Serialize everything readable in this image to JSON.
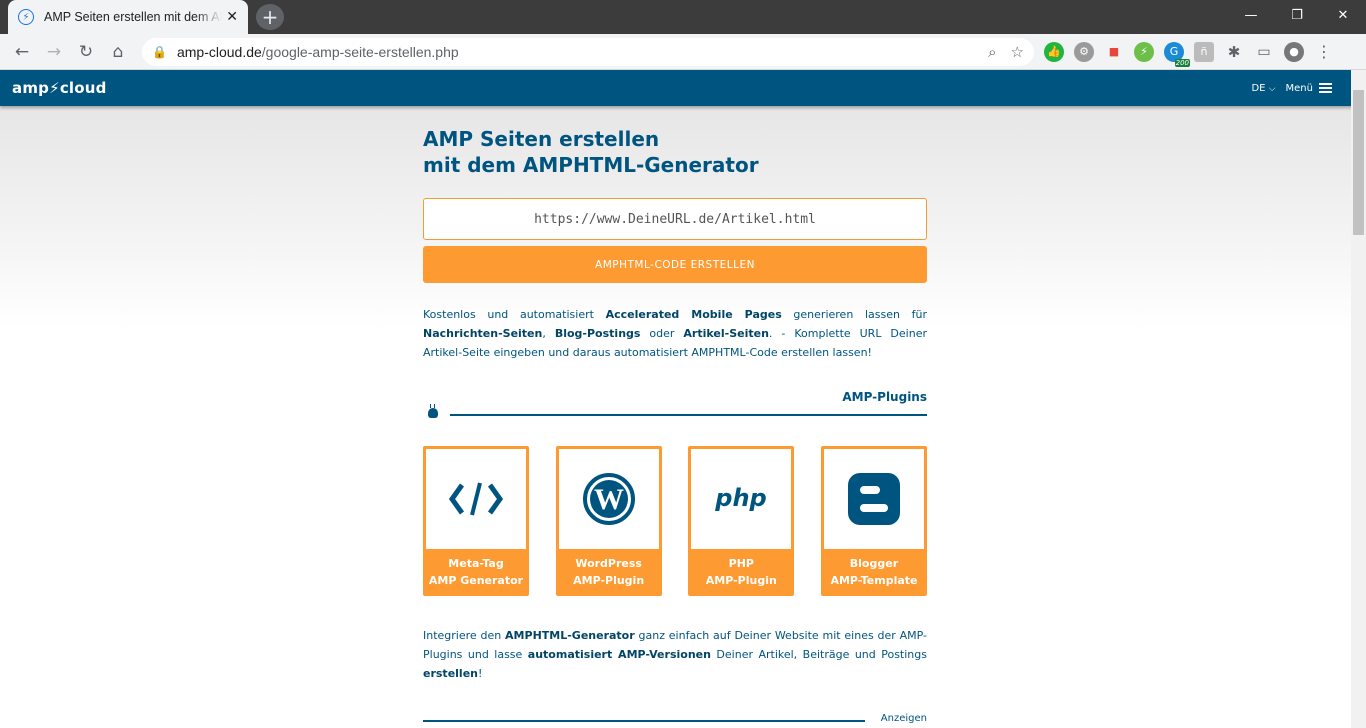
{
  "browser": {
    "tab_title": "AMP Seiten erstellen mit dem AMPHTML-Generator",
    "url_host": "amp-cloud.de",
    "url_path": "/google-amp-seite-erstellen.php",
    "ext_badge": "200"
  },
  "header": {
    "logo": "amp⚡cloud",
    "lang": "DE",
    "menu": "Menü"
  },
  "hero": {
    "title_line1": "AMP Seiten erstellen",
    "title_line2": "mit dem AMPHTML-Generator",
    "url_placeholder": "https://www.DeineURL.de/Artikel.html",
    "cta_label": "AMPHTML-CODE ERSTELLEN"
  },
  "intro": {
    "t1": "Kostenlos und automatisiert ",
    "b1": "Accelerated Mobile Pages",
    "t2": " generieren lassen für ",
    "b2": "Nachrichten-Seiten",
    "t3": ", ",
    "b3": "Blog-Postings",
    "t4": " oder ",
    "b4": "Artikel-Seiten",
    "t5": ". - Komplette URL Deiner Artikel-Seite eingeben und daraus automatisiert AMPHTML-Code erstellen lassen!"
  },
  "plugins": {
    "section_label": "AMP-Plugins",
    "cards": [
      {
        "line1": "Meta-Tag",
        "line2": "AMP Generator",
        "icon": "code-icon"
      },
      {
        "line1": "WordPress",
        "line2": "AMP-Plugin",
        "icon": "wordpress-icon"
      },
      {
        "line1": "PHP",
        "line2": "AMP-Plugin",
        "icon": "php-icon"
      },
      {
        "line1": "Blogger",
        "line2": "AMP-Template",
        "icon": "blogger-icon"
      }
    ]
  },
  "outro": {
    "t1": "Integriere den ",
    "b1": "AMPHTML-Generator",
    "t2": " ganz einfach auf Deiner Website mit eines der AMP-Plugins und lasse ",
    "b2": "automatisiert AMP-Versionen",
    "t3": " Deiner Artikel, Beiträge und Postings ",
    "b3": "erstellen",
    "t4": "!"
  },
  "ads_label": "Anzeigen",
  "colors": {
    "brand": "#005480",
    "accent": "#fe9a32"
  }
}
